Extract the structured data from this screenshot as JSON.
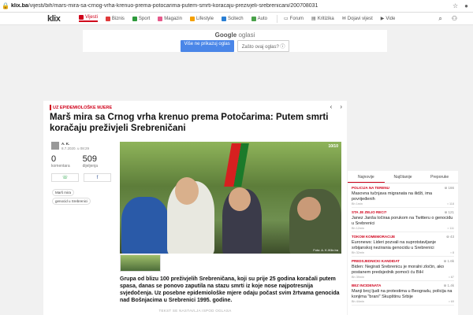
{
  "browser": {
    "url_domain": "klix.ba",
    "url_path": "/vijesti/bih/mars-mira-sa-crnog-vrha-krenuo-prema-potocarima-putem-smrti-koracaju-prezivjeli-srebrenicani/200708031"
  },
  "nav": {
    "logo": "klix",
    "items": [
      {
        "label": "Vijesti",
        "color": "#d0021b",
        "active": true
      },
      {
        "label": "Biznis",
        "color": "#e03a3a"
      },
      {
        "label": "Sport",
        "color": "#2e9a3c"
      },
      {
        "label": "Magazin",
        "color": "#e65a8b"
      },
      {
        "label": "Lifestyle",
        "color": "#f4a000"
      },
      {
        "label": "Scitech",
        "color": "#2a7fd4"
      },
      {
        "label": "Auto",
        "color": "#4aa24a"
      }
    ],
    "items2": [
      {
        "label": "Forum"
      },
      {
        "label": "Kritizika"
      },
      {
        "label": "Dojavi vijest"
      },
      {
        "label": "Vide"
      }
    ]
  },
  "ad": {
    "google": "Google",
    "oglasi": "oglasi",
    "btn_hide": "Više ne prikazuj oglas",
    "btn_why": "Zašto ovaj oglas?"
  },
  "article": {
    "category": "UZ EPIDEMIOLOŠKE MJERE",
    "title": "Marš mira sa Crnog vrha krenuo prema Potočarima: Putem smrti koračaju preživjeli Srebreničani",
    "author": "A. K.",
    "date": "8.7.2020. u 08:29",
    "comments_num": "0",
    "comments_lbl": "komentara",
    "shares_num": "509",
    "shares_lbl": "dijeljenja",
    "share_wa": "☏",
    "share_fb": "f",
    "tags": [
      "Marš mira",
      "genocid u Srebrenici"
    ],
    "photo_counter": "10/10",
    "photo_credit": "Foto: A. K./Klix.ba",
    "lead": "Grupa od blizu 100 preživjelih Srebreničana, koji su prije 25 godina koračali putem spasa, danas se ponovo zaputila na stazu smrti iz koje nose najpotresnija svjedočenja. Uz posebne epidemiološke mjere odaju počast svim žrtvama genocida nad Bošnjacima u Srebrenici 1995. godine.",
    "ad_text": "TEKST SE NASTAVLJA ISPOD OGLASA"
  },
  "sidebar": {
    "tabs": [
      "Najnovije",
      "Najčitanije",
      "Preporuke"
    ],
    "news": [
      {
        "kicker": "POLICIJA NA TERENU",
        "count": "166",
        "title": "Masovna tučnjava migranata na ilidži, ima povrijeđenih",
        "time": "Bh 1min",
        "comments": "118"
      },
      {
        "kicker": "STA JE ZELIO RECI?",
        "count": "121",
        "title": "Janez Janša ločiraa porukom na Twitteru o genocidu u Srebrenici",
        "time": "Bh 12min",
        "comments": "111"
      },
      {
        "kicker": "TOKOM KOMEMORACIJE",
        "count": "43",
        "title": "Euronews: Lideri pozvali na suprotstavljanje srbijanskoj nezirania genocidu u Srebrenici",
        "time": "Bh 32min",
        "comments": "8"
      },
      {
        "kicker": "PREDSJEDNICKI KANDIDAT",
        "count": "1.6k",
        "title": "Biden: Negirati Srebrenicu je moralni zločin, ako postanem predsjednik pomoći ću BiH",
        "time": "Bh 39min",
        "comments": "87"
      },
      {
        "kicker": "BEZ INCIDENATA",
        "count": "1.4k",
        "title": "Manji broj ljudi na protestima u Beogradu, policija na konjima \"brani\" Skupštinu Srbije",
        "time": "Bh 44min",
        "comments": "69"
      }
    ]
  }
}
